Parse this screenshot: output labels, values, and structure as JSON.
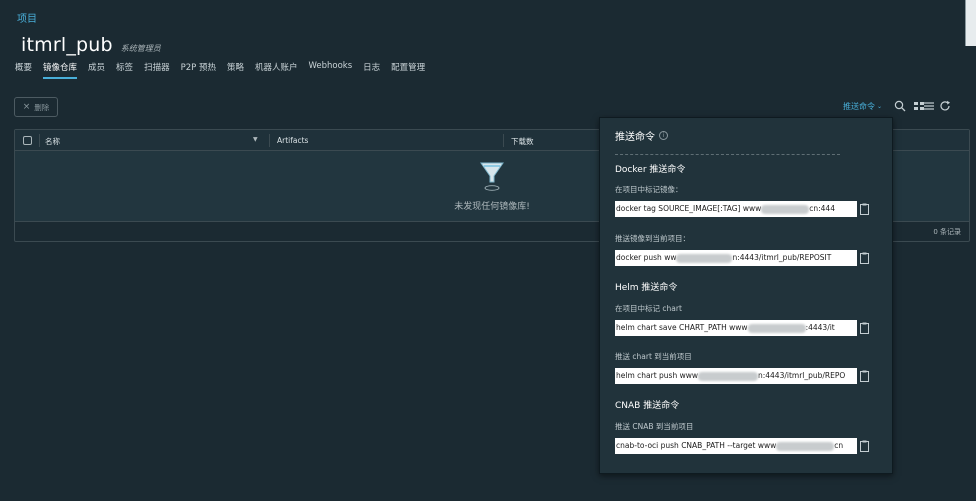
{
  "breadcrumb": "项目",
  "project": {
    "name": "itmrl_pub",
    "role": "系统管理员"
  },
  "tabs": [
    "概要",
    "镜像仓库",
    "成员",
    "标签",
    "扫描器",
    "P2P 预热",
    "策略",
    "机器人账户",
    "Webhooks",
    "日志",
    "配置管理"
  ],
  "active_tab": "镜像仓库",
  "toolbar": {
    "delete_label": "删除",
    "push_command_label": "推送命令"
  },
  "grid": {
    "columns": [
      "名称",
      "Artifacts",
      "下载数"
    ],
    "empty_text": "未发现任何镜像库!",
    "footer": "0 条记录"
  },
  "push_panel": {
    "title": "推送命令",
    "docker": {
      "title": "Docker 推送命令",
      "tag_label": "在项目中标记镜像：",
      "tag_cmd": "docker tag SOURCE_IMAGE[:TAG] www",
      "tag_cmd_tail": "cn:444",
      "push_label": "推送镜像到当前项目：",
      "push_cmd": "docker push ww",
      "push_cmd_tail": "n:4443/itmrl_pub/REPOSIT"
    },
    "helm": {
      "title": "Helm 推送命令",
      "tag_label": "在项目中标记 chart",
      "tag_cmd": "helm chart save CHART_PATH www",
      "tag_cmd_tail": ":4443/it",
      "push_label": "推送 chart 到当前项目",
      "push_cmd": "helm chart push www",
      "push_cmd_tail": "n:4443/itmrl_pub/REPO"
    },
    "cnab": {
      "title": "CNAB 推送命令",
      "push_label": "推送 CNAB 到当前项目",
      "push_cmd": "cnab-to-oci push CNAB_PATH --target www",
      "push_cmd_tail": "cn"
    }
  }
}
